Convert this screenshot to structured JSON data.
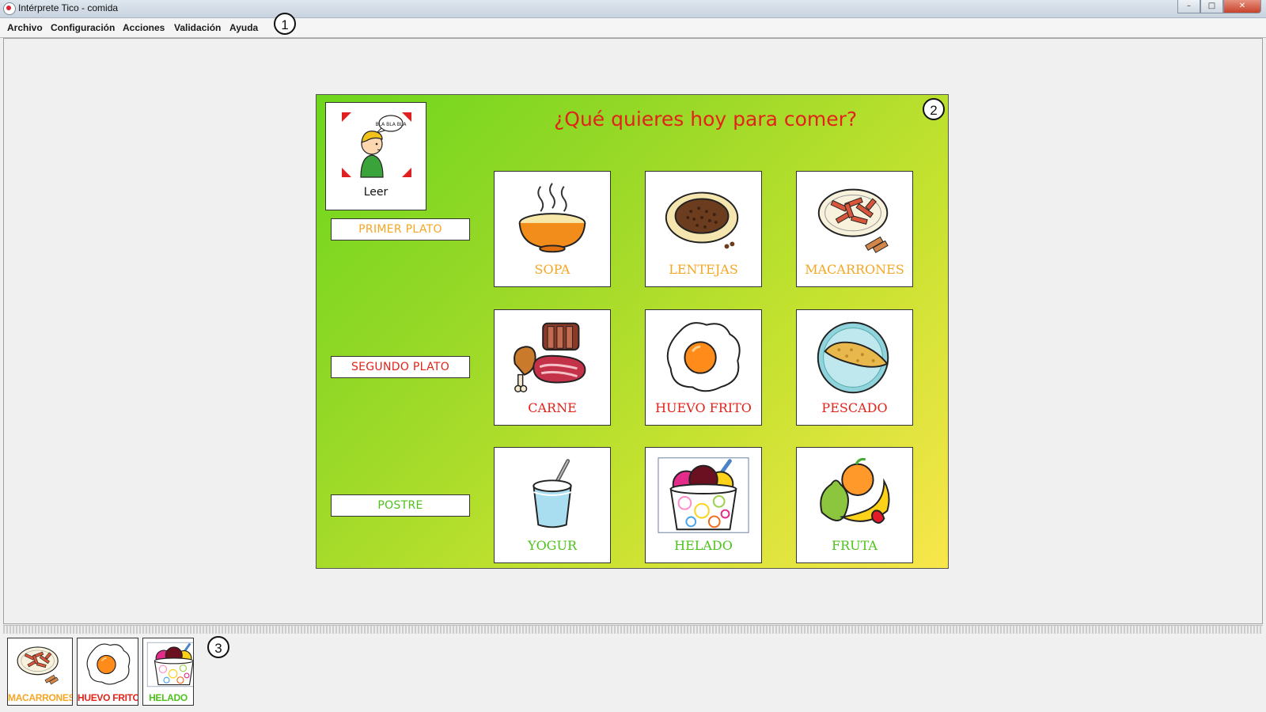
{
  "window": {
    "title": "Intérprete Tico - comida"
  },
  "menu": [
    "Archivo",
    "Configuración",
    "Acciones",
    "Validación",
    "Ayuda"
  ],
  "callouts": [
    "1",
    "2",
    "3"
  ],
  "board": {
    "title": "¿Qué quieres hoy para comer?",
    "title_color": "#e2231a",
    "leer": "Leer",
    "speech_text": "BLA BLA BLA",
    "rows": [
      {
        "label": "PRIMER PLATO",
        "color": "#f5a623"
      },
      {
        "label": "SEGUNDO PLATO",
        "color": "#e2231a"
      },
      {
        "label": "POSTRE",
        "color": "#4cc21b"
      }
    ],
    "cells": [
      {
        "label": "SOPA",
        "icon": "soup-icon",
        "color": "#f5a623"
      },
      {
        "label": "LENTEJAS",
        "icon": "lentils-icon",
        "color": "#f5a623"
      },
      {
        "label": "MACARRONES",
        "icon": "macaroni-icon",
        "color": "#f5a623"
      },
      {
        "label": "CARNE",
        "icon": "meat-icon",
        "color": "#e2231a"
      },
      {
        "label": "HUEVO FRITO",
        "icon": "fried-egg-icon",
        "color": "#e2231a"
      },
      {
        "label": "PESCADO",
        "icon": "fish-icon",
        "color": "#e2231a"
      },
      {
        "label": "YOGUR",
        "icon": "yogurt-icon",
        "color": "#4cc21b"
      },
      {
        "label": "HELADO",
        "icon": "ice-cream-icon",
        "color": "#4cc21b"
      },
      {
        "label": "FRUTA",
        "icon": "fruit-icon",
        "color": "#4cc21b"
      }
    ]
  },
  "selection": [
    {
      "label": "MACARRONES",
      "icon": "macaroni-icon",
      "color": "#f5a623"
    },
    {
      "label": "HUEVO FRITO",
      "icon": "fried-egg-icon",
      "color": "#e2231a"
    },
    {
      "label": "HELADO",
      "icon": "ice-cream-icon",
      "color": "#4cc21b"
    }
  ]
}
